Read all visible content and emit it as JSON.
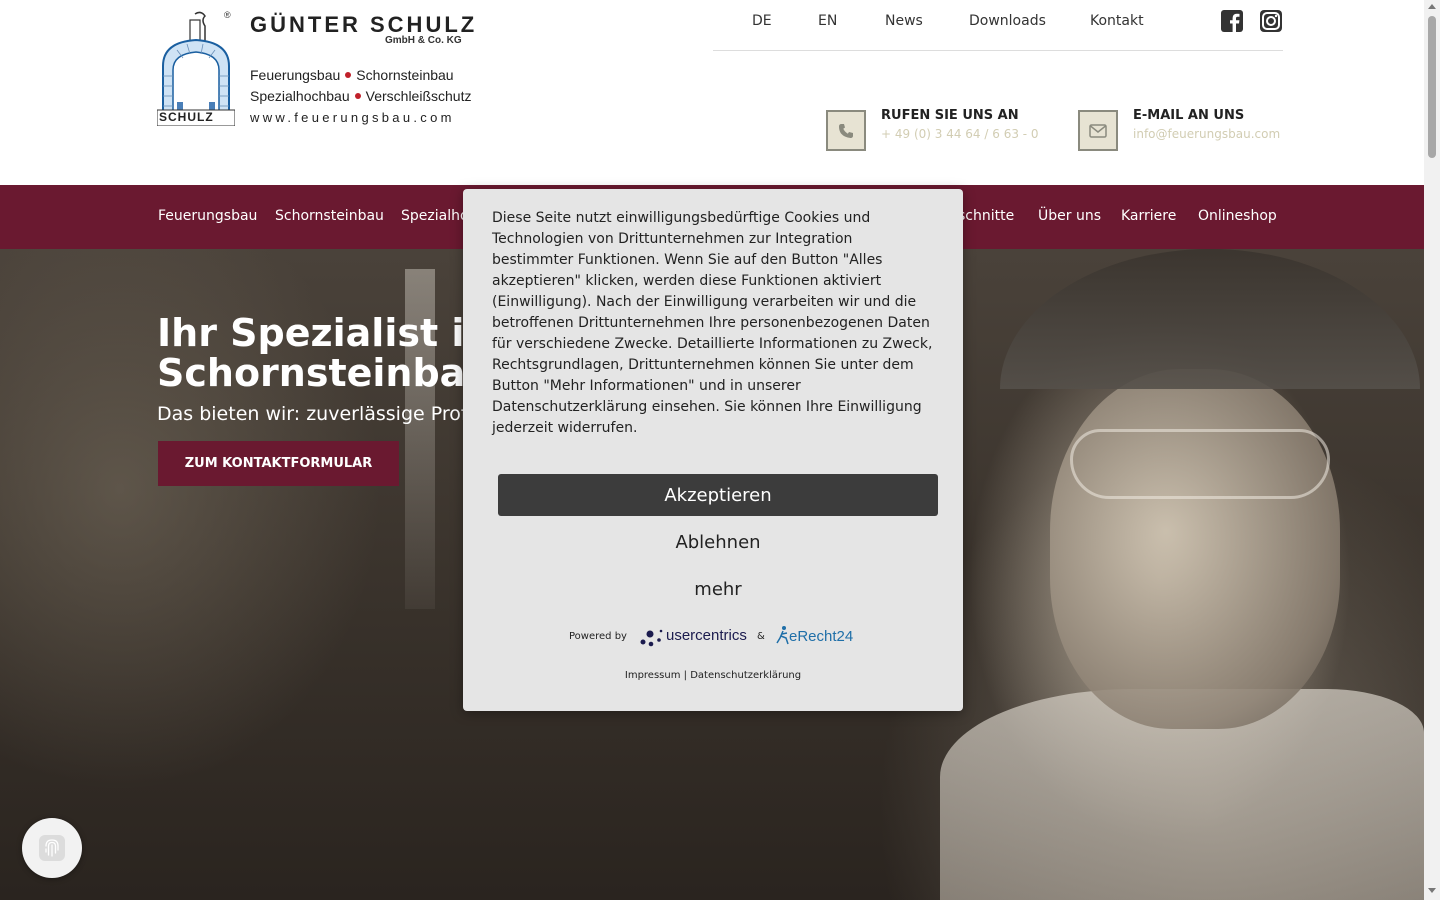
{
  "logo": {
    "company": "GÜNTER SCHULZ",
    "company_suffix": "GmbH & Co. KG",
    "registered": "®",
    "line1_a": "Feuerungsbau",
    "line1_b": "Schornsteinbau",
    "line2_a": "Spezialhochbau",
    "line2_b": "Verschleißschutz",
    "url": "www.feuerungsbau.com",
    "tag": "SCHULZ"
  },
  "topnav": {
    "items": [
      "DE",
      "EN",
      "News",
      "Downloads",
      "Kontakt"
    ],
    "social": [
      "facebook-icon",
      "instagram-icon"
    ]
  },
  "contact": {
    "phone_title": "RUFEN SIE UNS AN",
    "phone_value": "+ 49 (0) 3 44 64 / 6 63 - 0",
    "email_title": "E-MAIL AN UNS",
    "email_value": "info@feuerungsbau.com"
  },
  "mainnav": {
    "items": [
      "Feuerungsbau",
      "Schornsteinbau",
      "Spezialho",
      "schnitte",
      "Über uns",
      "Karriere",
      "Onlineshop"
    ]
  },
  "hero": {
    "title_line1": "Ihr Spezialist im",
    "title_line2": "Schornsteinbau",
    "subtitle": "Das bieten wir: zuverlässige Profi",
    "button": "ZUM KONTAKTFORMULAR"
  },
  "consent": {
    "text": "Diese Seite nutzt einwilligungsbedürftige Cookies und Technologien von Drittunternehmen zur Integration bestimmter Funktionen. Wenn Sie auf den Button \"Alles akzeptieren\" klicken, werden diese Funktionen aktiviert (Einwilligung). Nach der Einwilligung verarbeiten wir und die betroffenen Drittunternehmen Ihre personenbezogenen Daten für verschiedene Zwecke. Detaillierte Informationen zu Zweck, Rechtsgrundlagen, Drittunternehmen können Sie unter dem Button \"Mehr Informationen\" und in unserer Datenschutzerklärung einsehen. Sie können Ihre Einwilligung jederzeit widerrufen.",
    "accept": "Akzeptieren",
    "deny": "Ablehnen",
    "more": "mehr",
    "powered_by": "Powered by",
    "usercentrics": "usercentrics",
    "amp": "&",
    "erecht": "eRecht24",
    "impressum": "Impressum",
    "separator": "|",
    "datenschutz": "Datenschutzerklärung"
  },
  "colors": {
    "brand": "#6a1930",
    "modal_bg": "#e5e5e5",
    "accept_bg": "#3c3c3c",
    "contact_muted": "#d2cdb3"
  }
}
